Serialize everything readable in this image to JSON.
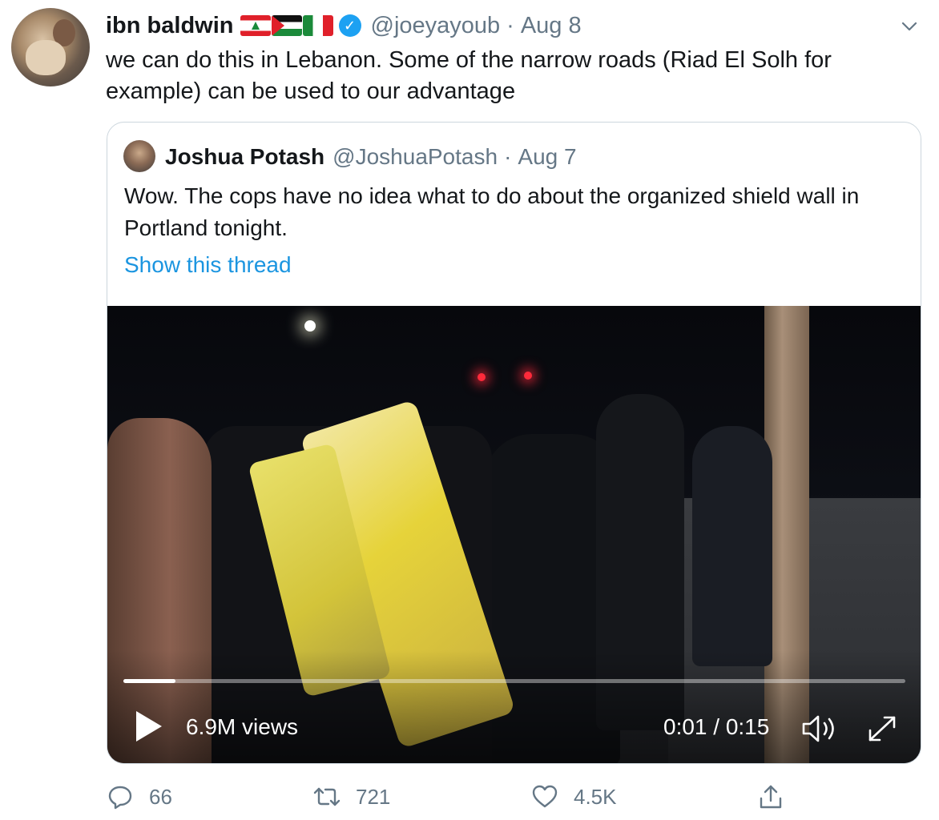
{
  "tweet": {
    "display_name": "ibn baldwin",
    "handle": "@joeyayoub",
    "separator": "·",
    "date": "Aug 8",
    "verified_mark": "✓",
    "text": "we can do this in Lebanon. Some of the narrow roads (Riad El Solh for example) can be used to our advantage",
    "flags": [
      "lebanon-flag",
      "palestine-flag",
      "italy-flag"
    ]
  },
  "quoted_tweet": {
    "display_name": "Joshua Potash",
    "handle": "@JoshuaPotash",
    "separator": "·",
    "date": "Aug 7",
    "text": "Wow. The cops have no idea what to do about the organized shield wall in Portland tonight.",
    "show_thread": "Show this thread"
  },
  "video": {
    "views": "6.9M views",
    "time": "0:01 / 0:15",
    "progress": 0.067
  },
  "actions": {
    "reply_count": "66",
    "retweet_count": "721",
    "like_count": "4.5K"
  },
  "colors": {
    "link": "#1b95e0",
    "verified": "#1da1f2",
    "secondary_text": "#657786"
  }
}
